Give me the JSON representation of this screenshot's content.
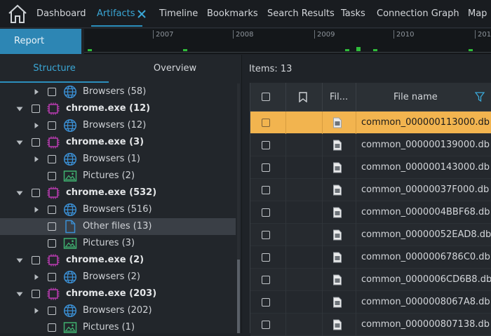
{
  "nav": {
    "tabs": [
      {
        "label": "Dashboard"
      },
      {
        "label": "Artifacts",
        "active": true
      },
      {
        "label": "Timeline"
      },
      {
        "label": "Bookmarks"
      },
      {
        "label": "Search Results"
      },
      {
        "label": "Tasks"
      },
      {
        "label": "Connection Graph"
      },
      {
        "label": "Map"
      }
    ]
  },
  "toolbar": {
    "report_label": "Report"
  },
  "timeline": {
    "years": [
      "2007",
      "2008",
      "2009",
      "2010",
      "201"
    ]
  },
  "left": {
    "tabs": [
      "Structure",
      "Overview"
    ],
    "tree": [
      {
        "label": "Browsers (58)",
        "icon": "globe-icon",
        "expand": "collapsed"
      },
      {
        "label": "chrome.exe (12)",
        "icon": "chip-icon",
        "expand": "expanded",
        "bold": true
      },
      {
        "label": "Browsers (12)",
        "icon": "globe-icon",
        "expand": "collapsed"
      },
      {
        "label": "chrome.exe (3)",
        "icon": "chip-icon",
        "expand": "expanded",
        "bold": true
      },
      {
        "label": "Browsers (1)",
        "icon": "globe-icon",
        "expand": "collapsed"
      },
      {
        "label": "Pictures (2)",
        "icon": "picture-icon",
        "expand": "none"
      },
      {
        "label": "chrome.exe (532)",
        "icon": "chip-icon",
        "expand": "expanded",
        "bold": true
      },
      {
        "label": "Browsers (516)",
        "icon": "globe-icon",
        "expand": "collapsed"
      },
      {
        "label": "Other files (13)",
        "icon": "file-icon",
        "expand": "none",
        "selected": true
      },
      {
        "label": "Pictures (3)",
        "icon": "picture-icon",
        "expand": "none"
      },
      {
        "label": "chrome.exe (2)",
        "icon": "chip-icon",
        "expand": "expanded",
        "bold": true
      },
      {
        "label": "Browsers (2)",
        "icon": "globe-icon",
        "expand": "collapsed"
      },
      {
        "label": "chrome.exe (203)",
        "icon": "chip-icon",
        "expand": "expanded",
        "bold": true
      },
      {
        "label": "Browsers (202)",
        "icon": "globe-icon",
        "expand": "collapsed"
      },
      {
        "label": "Pictures (1)",
        "icon": "picture-icon",
        "expand": "none"
      }
    ]
  },
  "right": {
    "items_label": "Items: 13",
    "columns": {
      "file_type": "Fil...",
      "file_name": "File name"
    },
    "rows": [
      {
        "name": "common_000000113000.db",
        "highlighted": true
      },
      {
        "name": "common_000000139000.db"
      },
      {
        "name": "common_000000143000.db"
      },
      {
        "name": "common_00000037F000.db"
      },
      {
        "name": "common_0000004BBF68.db"
      },
      {
        "name": "common_00000052EAD8.db"
      },
      {
        "name": "common_0000006786C0.db"
      },
      {
        "name": "common_0000006CD6B8.db"
      },
      {
        "name": "common_0000008067A8.db"
      },
      {
        "name": "common_000000807138.db"
      }
    ]
  },
  "colors": {
    "accent": "#3aa7d6",
    "report_button": "#2d86b4",
    "row_highlight": "#f2b44f",
    "timeline_mark": "#2fbd3a",
    "chip_icon": "#b03aa8",
    "globe_icon": "#3b8fd4",
    "picture_icon": "#3fb070"
  }
}
